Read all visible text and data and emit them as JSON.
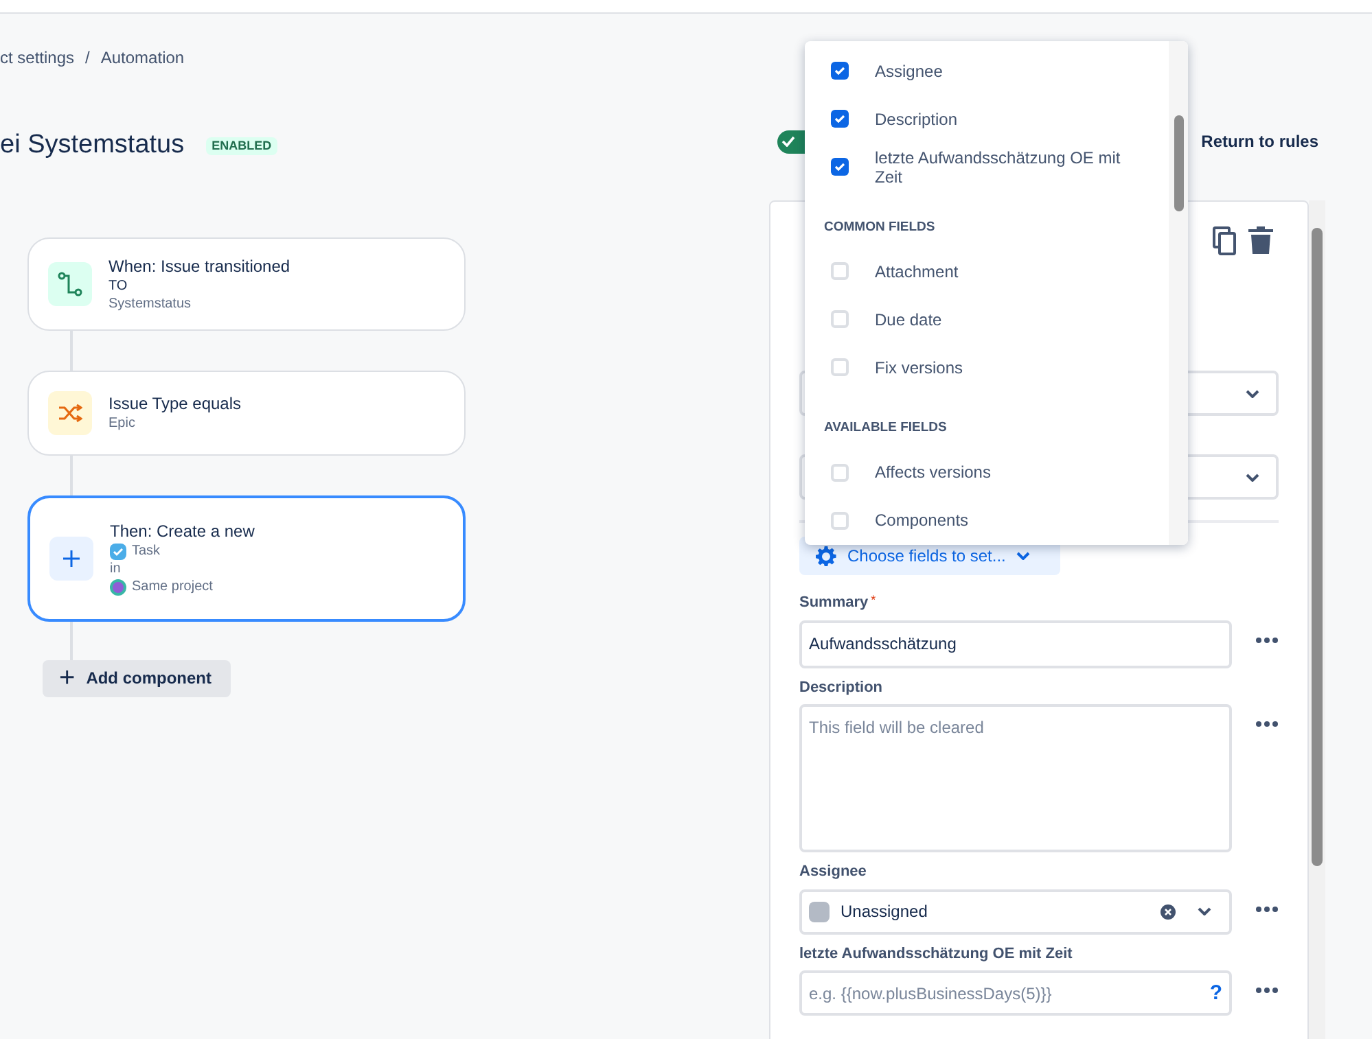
{
  "breadcrumb": {
    "items": [
      "ct settings",
      "Automation"
    ],
    "separator": "/"
  },
  "title": "ei Systemstatus",
  "status_badge": "ENABLED",
  "flow": [
    {
      "kind": "trigger",
      "title": "When: Issue transitioned",
      "lines": [
        "TO",
        "Systemstatus"
      ],
      "selected": false
    },
    {
      "kind": "condition",
      "title": "Issue Type equals",
      "lines": [
        "Epic"
      ],
      "selected": false
    },
    {
      "kind": "action",
      "title": "Then: Create a new",
      "lines": [
        "Task",
        "in",
        "Same project"
      ],
      "selected": true
    }
  ],
  "add_component": {
    "icon": "+",
    "label": "Add component"
  },
  "rule_toggle": {
    "on": true
  },
  "return_link": "Return to rules",
  "panel": {
    "choose_fields_button": "Choose fields to set...",
    "fields": [
      {
        "kind": "text",
        "label": "Summary",
        "required_mark": "*",
        "value": "Aufwandsschätzung"
      },
      {
        "kind": "textarea",
        "label": "Description",
        "placeholder": "This field will be cleared"
      },
      {
        "kind": "user",
        "label": "Assignee",
        "value": "Unassigned"
      },
      {
        "kind": "smart",
        "label": "letzte Aufwandsschätzung OE mit Zeit",
        "placeholder": "e.g. {{now.plusBusinessDays(5)}}",
        "help": "?"
      }
    ]
  },
  "field_menu": {
    "sections": [
      {
        "items": [
          {
            "label": "Assignee",
            "checked": true
          },
          {
            "label": "Description",
            "checked": true
          },
          {
            "label": "letzte Aufwandsschätzung OE mit Zeit",
            "checked": true
          }
        ]
      },
      {
        "heading": "COMMON FIELDS",
        "items": [
          {
            "label": "Attachment",
            "checked": false
          },
          {
            "label": "Due date",
            "checked": false
          },
          {
            "label": "Fix versions",
            "checked": false
          }
        ]
      },
      {
        "heading": "AVAILABLE FIELDS",
        "items": [
          {
            "label": "Affects versions",
            "checked": false
          },
          {
            "label": "Components",
            "checked": false
          }
        ]
      }
    ]
  }
}
